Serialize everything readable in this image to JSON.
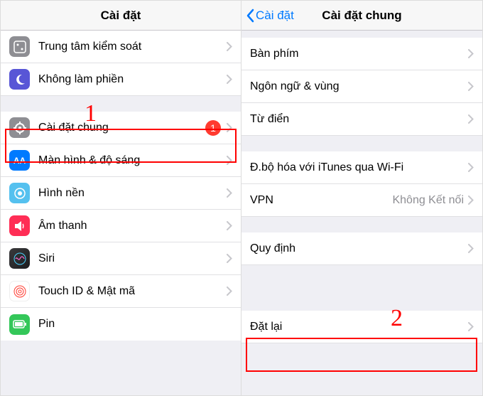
{
  "left": {
    "title": "Cài đặt",
    "rows": {
      "control": "Trung tâm kiểm soát",
      "dnd": "Không làm phiền",
      "general": "Cài đặt chung",
      "general_badge": "1",
      "display": "Màn hình & độ sáng",
      "wallpaper": "Hình nền",
      "sound": "Âm thanh",
      "siri": "Siri",
      "touchid": "Touch ID & Mật mã",
      "pin": "Pin"
    }
  },
  "right": {
    "back": "Cài đặt",
    "title": "Cài đặt chung",
    "rows": {
      "keyboard": "Bàn phím",
      "language": "Ngôn ngữ & vùng",
      "dictionary": "Từ điển",
      "itunes": "Đ.bộ hóa với iTunes qua Wi-Fi",
      "vpn_label": "VPN",
      "vpn_value": "Không Kết nối",
      "regulatory": "Quy định",
      "reset": "Đặt lại"
    }
  },
  "annotations": {
    "num1": "1",
    "num2": "2"
  }
}
